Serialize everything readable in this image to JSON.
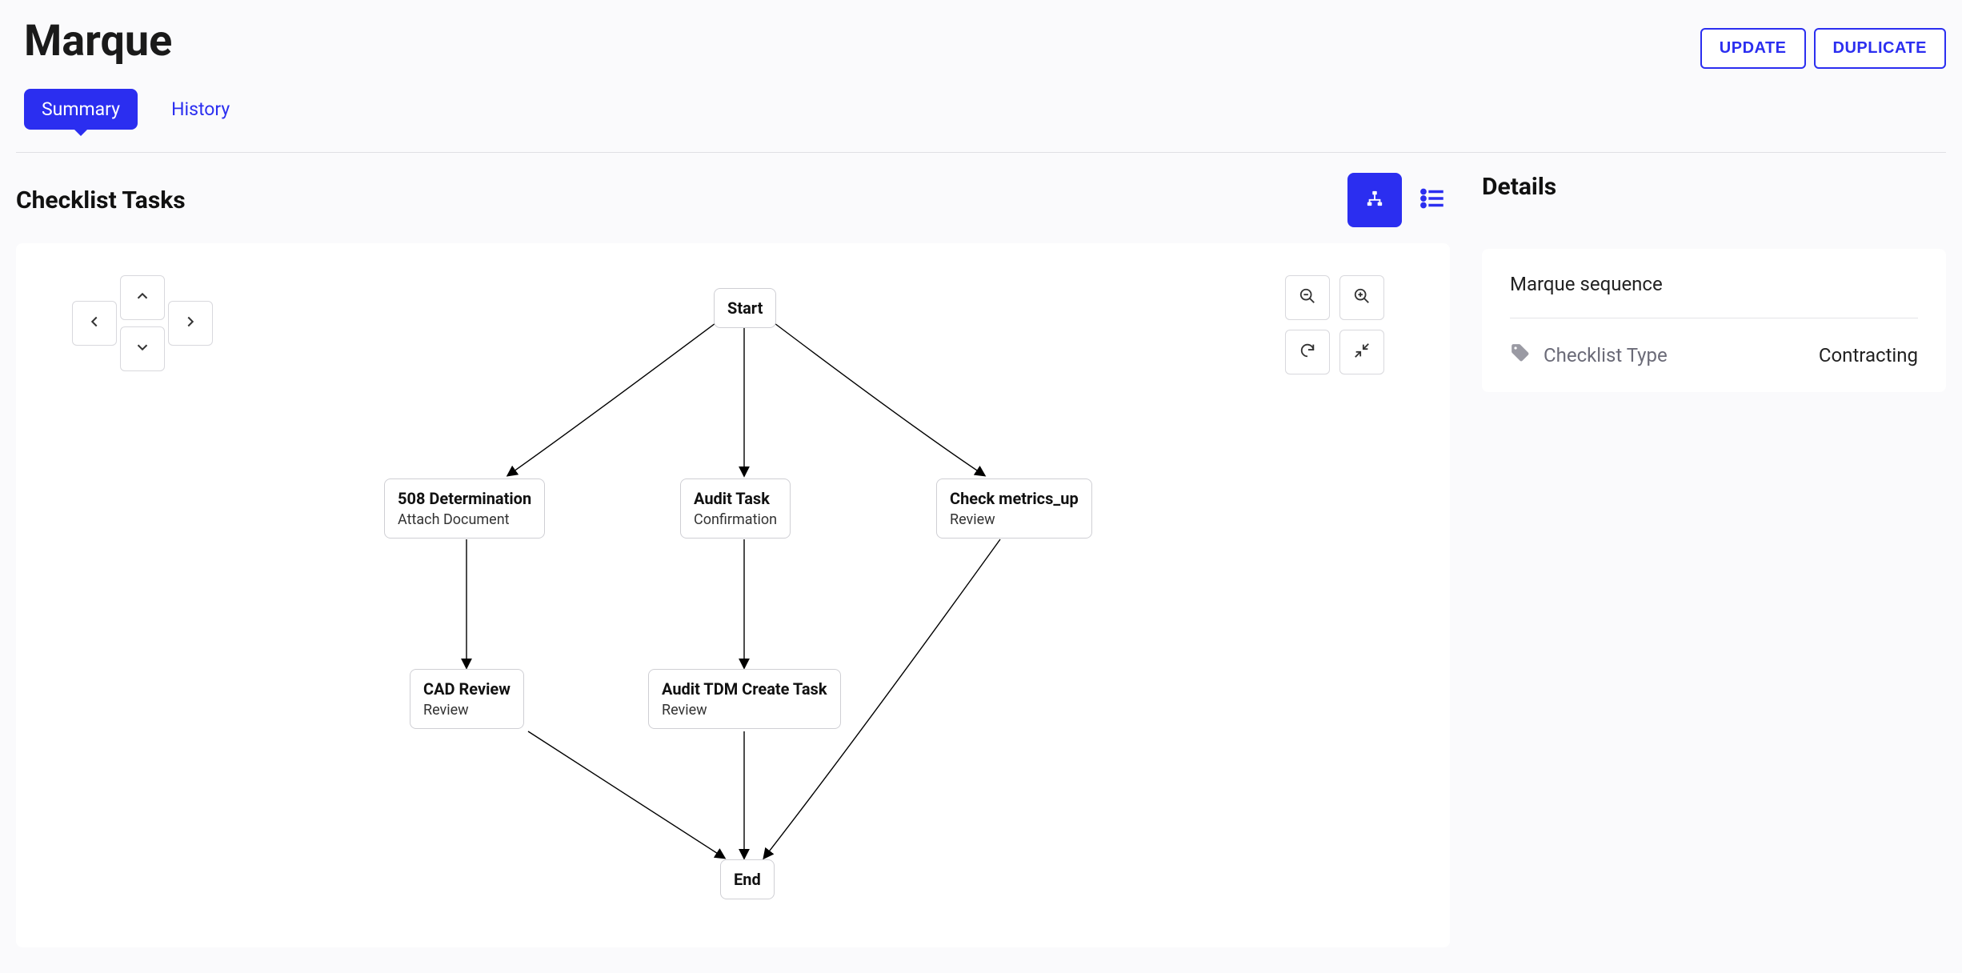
{
  "header": {
    "title": "Marque",
    "buttons": {
      "update": "UPDATE",
      "duplicate": "DUPLICATE"
    }
  },
  "tabs": {
    "summary": "Summary",
    "history": "History"
  },
  "checklist": {
    "heading": "Checklist Tasks"
  },
  "diagram": {
    "nodes": {
      "start": "Start",
      "n508": {
        "title": "508 Determination",
        "type": "Attach Document"
      },
      "auditTask": {
        "title": "Audit Task",
        "type": "Confirmation"
      },
      "checkMetrics": {
        "title": "Check metrics_up",
        "type": "Review"
      },
      "cadReview": {
        "title": "CAD Review",
        "type": "Review"
      },
      "auditTdm": {
        "title": "Audit TDM Create Task",
        "type": "Review"
      },
      "end": "End"
    }
  },
  "details": {
    "heading": "Details",
    "title": "Marque sequence",
    "checklistTypeLabel": "Checklist Type",
    "checklistTypeValue": "Contracting"
  }
}
